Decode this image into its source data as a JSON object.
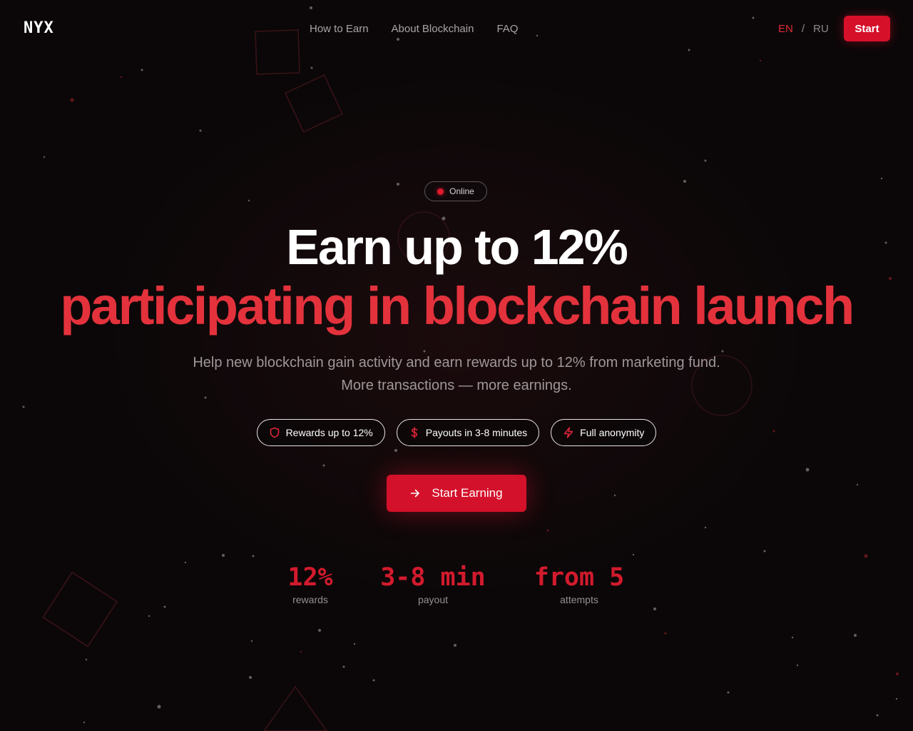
{
  "header": {
    "logo": "NYX",
    "nav": [
      "How to Earn",
      "About Blockchain",
      "FAQ"
    ],
    "lang": {
      "active": "EN",
      "separator": "/",
      "other": "RU"
    },
    "start_label": "Start"
  },
  "hero": {
    "status": "Online",
    "title_line1": "Earn up to 12%",
    "title_line2": "participating in blockchain launch",
    "subtitle": "Help new blockchain gain activity and earn rewards up to 12% from marketing fund. More transactions — more earnings.",
    "features": [
      {
        "icon": "shield-icon",
        "label": "Rewards up to 12%"
      },
      {
        "icon": "dollar-icon",
        "label": "Payouts in 3-8 minutes"
      },
      {
        "icon": "lightning-icon",
        "label": "Full anonymity"
      }
    ],
    "cta_label": "Start Earning"
  },
  "stats": [
    {
      "value": "12%",
      "label": "rewards"
    },
    {
      "value": "3-8 min",
      "label": "payout"
    },
    {
      "value": "from 5",
      "label": "attempts"
    }
  ],
  "colors": {
    "accent": "#d4112a",
    "accent_text": "#e3323c",
    "background": "#0b0708"
  }
}
